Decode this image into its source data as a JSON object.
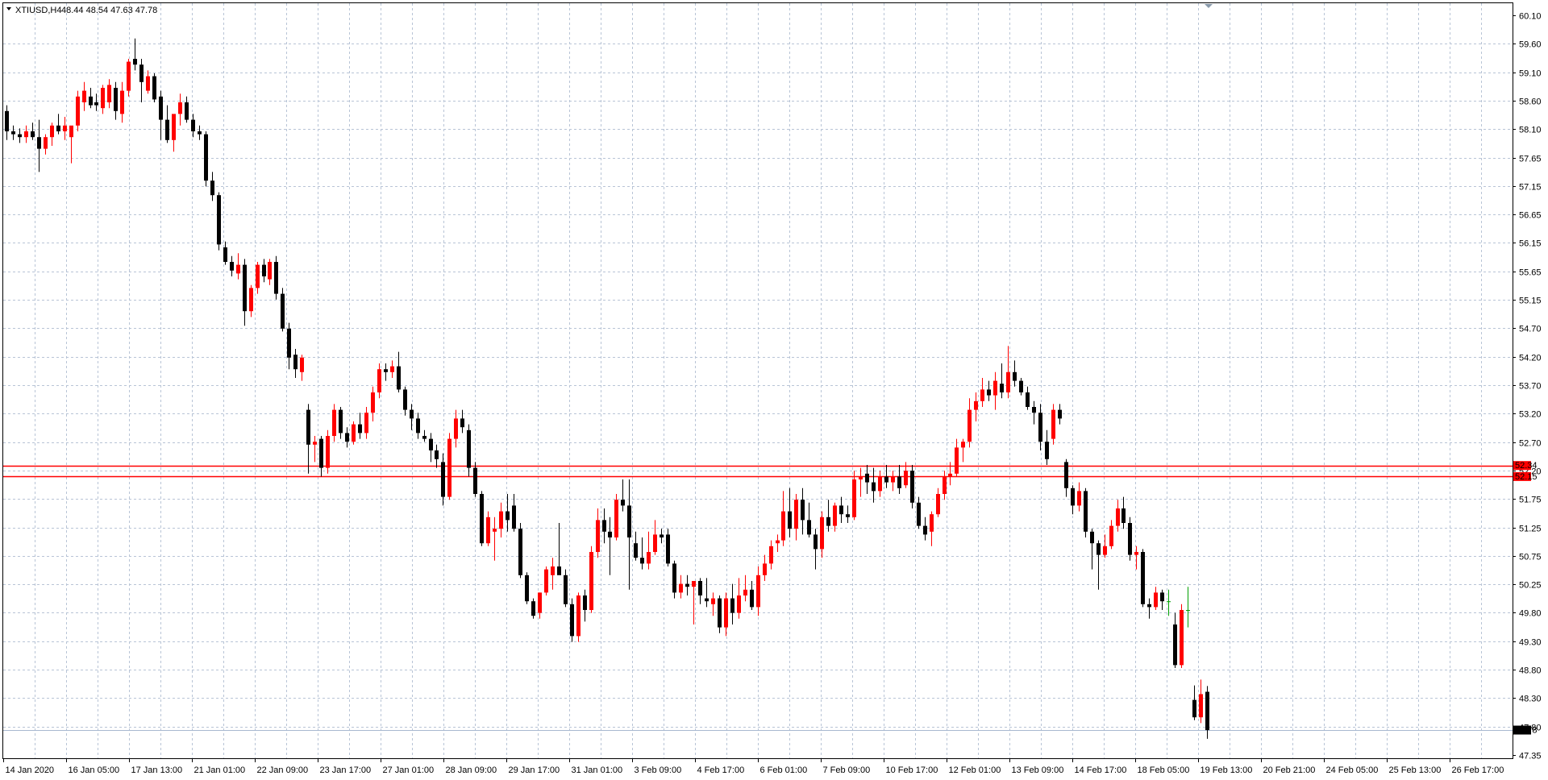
{
  "window": {
    "symbol_label": "XTIUSD,H4",
    "ohlc_readout": "48.44 48.54 47.63 47.78"
  },
  "colors": {
    "background": "#ffffff",
    "grid": "#b8c4d6",
    "axis": "#000000",
    "bull_candle": "#ff0000",
    "bear_candle": "#000000",
    "doji": "#00a000",
    "level_line": "#ff0000",
    "bid_line": "#a8b8d0"
  },
  "chart_data": {
    "type": "candlestick",
    "title": "",
    "ylim": [
      47.35,
      60.1
    ],
    "y_ticks": [
      "60.10",
      "59.60",
      "59.10",
      "58.60",
      "58.10",
      "57.65",
      "57.15",
      "56.65",
      "56.15",
      "55.65",
      "55.15",
      "54.70",
      "54.20",
      "53.70",
      "53.20",
      "52.70",
      "52.20",
      "51.75",
      "51.25",
      "50.75",
      "50.25",
      "49.80",
      "49.30",
      "48.80",
      "48.30",
      "47.80",
      "47.35"
    ],
    "x_tick_labels": [
      "14 Jan 2020",
      "16 Jan 05:00",
      "17 Jan 13:00",
      "21 Jan 01:00",
      "22 Jan 09:00",
      "23 Jan 17:00",
      "27 Jan 01:00",
      "28 Jan 09:00",
      "29 Jan 17:00",
      "31 Jan 01:00",
      "3 Feb 09:00",
      "4 Feb 17:00",
      "6 Feb 01:00",
      "7 Feb 09:00",
      "10 Feb 17:00",
      "12 Feb 01:00",
      "13 Feb 09:00",
      "14 Feb 17:00",
      "18 Feb 05:00",
      "19 Feb 13:00",
      "20 Feb 21:00",
      "24 Feb 05:00",
      "25 Feb 13:00",
      "26 Feb 17:00"
    ],
    "horizontal_levels": [
      {
        "price": 52.34,
        "label": "52.34"
      },
      {
        "price": 52.15,
        "label": "52.15"
      }
    ],
    "current_price": {
      "price": 47.78,
      "label": "47.78"
    },
    "candles": [
      [
        58.45,
        58.55,
        57.95,
        58.1
      ],
      [
        58.1,
        58.2,
        57.95,
        58.05
      ],
      [
        58.05,
        58.15,
        57.9,
        58.0
      ],
      [
        58.0,
        58.2,
        57.9,
        58.1
      ],
      [
        58.1,
        58.25,
        57.95,
        58.0
      ],
      [
        58.0,
        58.3,
        57.4,
        57.8
      ],
      [
        57.8,
        58.05,
        57.7,
        58.0
      ],
      [
        58.0,
        58.25,
        57.85,
        58.2
      ],
      [
        58.2,
        58.4,
        58.05,
        58.1
      ],
      [
        58.1,
        58.35,
        57.95,
        58.2
      ],
      [
        58.0,
        58.15,
        57.55,
        58.2
      ],
      [
        58.2,
        58.8,
        58.1,
        58.7
      ],
      [
        58.6,
        58.95,
        58.45,
        58.8
      ],
      [
        58.7,
        58.85,
        58.5,
        58.55
      ],
      [
        58.6,
        58.75,
        58.45,
        58.55
      ],
      [
        58.5,
        58.9,
        58.4,
        58.85
      ],
      [
        58.6,
        59.0,
        58.5,
        58.9
      ],
      [
        58.85,
        58.95,
        58.3,
        58.45
      ],
      [
        58.4,
        58.95,
        58.25,
        58.8
      ],
      [
        58.8,
        59.35,
        58.7,
        59.3
      ],
      [
        59.35,
        59.7,
        59.15,
        59.25
      ],
      [
        59.25,
        59.35,
        58.6,
        58.95
      ],
      [
        58.8,
        59.15,
        58.75,
        59.05
      ],
      [
        59.05,
        59.1,
        58.6,
        58.65
      ],
      [
        58.7,
        58.8,
        57.95,
        58.3
      ],
      [
        58.3,
        58.55,
        57.9,
        57.95
      ],
      [
        57.95,
        58.35,
        57.75,
        58.4
      ],
      [
        58.4,
        58.75,
        58.2,
        58.6
      ],
      [
        58.6,
        58.7,
        58.25,
        58.3
      ],
      [
        58.3,
        58.4,
        58.0,
        58.1
      ],
      [
        58.1,
        58.2,
        57.95,
        58.05
      ],
      [
        58.05,
        58.1,
        57.15,
        57.25
      ],
      [
        57.25,
        57.4,
        56.9,
        57.0
      ],
      [
        57.0,
        57.05,
        56.05,
        56.15
      ],
      [
        56.1,
        56.2,
        55.8,
        55.85
      ],
      [
        55.85,
        55.95,
        55.6,
        55.7
      ],
      [
        55.65,
        56.0,
        55.55,
        55.8
      ],
      [
        55.8,
        55.9,
        54.75,
        55.0
      ],
      [
        55.0,
        55.45,
        54.9,
        55.4
      ],
      [
        55.4,
        55.85,
        55.3,
        55.8
      ],
      [
        55.8,
        55.9,
        55.5,
        55.6
      ],
      [
        55.55,
        55.9,
        55.45,
        55.85
      ],
      [
        55.85,
        55.95,
        55.2,
        55.3
      ],
      [
        55.3,
        55.4,
        54.65,
        54.7
      ],
      [
        54.7,
        54.8,
        54.0,
        54.2
      ],
      [
        54.25,
        54.35,
        53.85,
        54.0
      ],
      [
        53.95,
        54.25,
        53.8,
        54.2
      ],
      [
        53.3,
        53.4,
        52.2,
        52.7
      ],
      [
        52.7,
        52.85,
        52.4,
        52.75
      ],
      [
        52.8,
        52.85,
        52.15,
        52.3
      ],
      [
        52.3,
        52.95,
        52.2,
        52.85
      ],
      [
        52.85,
        53.4,
        52.75,
        53.3
      ],
      [
        53.3,
        53.35,
        52.8,
        52.9
      ],
      [
        52.9,
        53.0,
        52.65,
        52.75
      ],
      [
        52.75,
        53.1,
        52.7,
        53.05
      ],
      [
        53.05,
        53.25,
        52.8,
        52.9
      ],
      [
        52.9,
        53.35,
        52.8,
        53.25
      ],
      [
        53.25,
        53.7,
        53.1,
        53.6
      ],
      [
        53.6,
        54.1,
        53.5,
        54.0
      ],
      [
        54.0,
        54.1,
        53.8,
        53.95
      ],
      [
        53.95,
        54.15,
        53.85,
        54.05
      ],
      [
        54.05,
        54.3,
        53.6,
        53.65
      ],
      [
        53.65,
        53.7,
        53.2,
        53.3
      ],
      [
        53.3,
        53.4,
        52.95,
        53.15
      ],
      [
        53.15,
        53.25,
        52.8,
        52.9
      ],
      [
        52.85,
        52.95,
        52.75,
        52.8
      ],
      [
        52.8,
        52.9,
        52.4,
        52.6
      ],
      [
        52.6,
        52.7,
        52.3,
        52.45
      ],
      [
        52.4,
        52.55,
        51.65,
        51.8
      ],
      [
        51.8,
        52.9,
        51.75,
        52.8
      ],
      [
        52.8,
        53.3,
        52.65,
        53.15
      ],
      [
        53.15,
        53.3,
        52.9,
        53.0
      ],
      [
        52.95,
        53.05,
        52.15,
        52.3
      ],
      [
        52.3,
        52.4,
        51.8,
        51.85
      ],
      [
        51.85,
        51.9,
        50.95,
        51.0
      ],
      [
        51.0,
        51.55,
        50.95,
        51.45
      ],
      [
        51.2,
        51.45,
        50.7,
        51.25
      ],
      [
        51.25,
        51.7,
        51.1,
        51.55
      ],
      [
        51.55,
        51.85,
        51.2,
        51.4
      ],
      [
        51.65,
        51.85,
        51.2,
        51.25
      ],
      [
        51.25,
        51.35,
        50.4,
        50.45
      ],
      [
        50.45,
        50.5,
        49.95,
        50.0
      ],
      [
        50.0,
        50.05,
        49.7,
        49.75
      ],
      [
        49.8,
        50.15,
        49.7,
        50.15
      ],
      [
        50.15,
        50.6,
        50.1,
        50.55
      ],
      [
        50.45,
        50.75,
        50.2,
        50.6
      ],
      [
        50.6,
        51.35,
        50.55,
        50.45
      ],
      [
        50.45,
        50.55,
        49.9,
        49.95
      ],
      [
        49.95,
        50.05,
        49.3,
        49.4
      ],
      [
        49.4,
        50.15,
        49.3,
        50.1
      ],
      [
        50.1,
        50.2,
        49.65,
        49.85
      ],
      [
        49.85,
        50.95,
        49.8,
        50.85
      ],
      [
        50.85,
        51.6,
        50.75,
        51.4
      ],
      [
        51.4,
        51.6,
        51.0,
        51.2
      ],
      [
        51.2,
        51.45,
        50.45,
        51.1
      ],
      [
        51.1,
        51.85,
        51.05,
        51.75
      ],
      [
        51.75,
        52.1,
        51.55,
        51.65
      ],
      [
        51.65,
        52.1,
        50.2,
        51.1
      ],
      [
        51.0,
        51.2,
        50.7,
        50.75
      ],
      [
        50.75,
        51.1,
        50.55,
        50.65
      ],
      [
        50.65,
        51.2,
        50.55,
        50.85
      ],
      [
        50.85,
        51.4,
        50.8,
        51.15
      ],
      [
        51.15,
        51.25,
        51.0,
        51.1
      ],
      [
        51.15,
        51.25,
        50.6,
        50.65
      ],
      [
        50.65,
        50.7,
        50.05,
        50.15
      ],
      [
        50.15,
        50.45,
        50.05,
        50.3
      ],
      [
        50.3,
        50.45,
        50.1,
        50.25
      ],
      [
        50.25,
        50.35,
        49.6,
        50.35
      ],
      [
        50.35,
        50.4,
        49.95,
        50.1
      ],
      [
        50.05,
        50.4,
        49.9,
        50.0
      ],
      [
        49.95,
        50.15,
        49.75,
        50.05
      ],
      [
        50.05,
        50.1,
        49.45,
        49.55
      ],
      [
        49.55,
        50.15,
        49.4,
        50.05
      ],
      [
        50.05,
        50.3,
        49.6,
        49.8
      ],
      [
        49.8,
        50.4,
        49.7,
        50.1
      ],
      [
        50.1,
        50.45,
        50.0,
        50.2
      ],
      [
        50.2,
        50.35,
        49.85,
        49.9
      ],
      [
        49.9,
        50.6,
        49.75,
        50.45
      ],
      [
        50.45,
        50.8,
        50.35,
        50.65
      ],
      [
        50.65,
        51.05,
        50.55,
        50.95
      ],
      [
        51.0,
        51.15,
        50.85,
        51.05
      ],
      [
        51.05,
        51.9,
        50.95,
        51.55
      ],
      [
        51.55,
        51.95,
        51.1,
        51.25
      ],
      [
        51.25,
        51.85,
        51.05,
        51.75
      ],
      [
        51.75,
        51.95,
        51.15,
        51.4
      ],
      [
        51.4,
        51.7,
        51.1,
        51.15
      ],
      [
        51.15,
        51.25,
        50.55,
        50.9
      ],
      [
        50.9,
        51.55,
        50.75,
        51.45
      ],
      [
        51.45,
        51.75,
        51.2,
        51.3
      ],
      [
        51.3,
        51.7,
        51.2,
        51.65
      ],
      [
        51.65,
        51.8,
        51.35,
        51.5
      ],
      [
        51.5,
        51.65,
        51.35,
        51.45
      ],
      [
        51.45,
        52.25,
        51.4,
        52.1
      ],
      [
        52.1,
        52.3,
        51.8,
        52.15
      ],
      [
        52.2,
        52.35,
        51.85,
        52.05
      ],
      [
        52.05,
        52.3,
        51.7,
        51.9
      ],
      [
        51.9,
        52.25,
        51.8,
        52.15
      ],
      [
        52.15,
        52.35,
        51.95,
        52.05
      ],
      [
        52.05,
        52.25,
        51.9,
        52.15
      ],
      [
        52.15,
        52.35,
        51.85,
        51.95
      ],
      [
        52.0,
        52.4,
        51.95,
        52.25
      ],
      [
        52.25,
        52.35,
        51.6,
        51.7
      ],
      [
        51.7,
        51.8,
        51.25,
        51.3
      ],
      [
        51.3,
        51.45,
        51.05,
        51.15
      ],
      [
        51.2,
        51.55,
        50.95,
        51.5
      ],
      [
        51.5,
        51.95,
        51.45,
        51.85
      ],
      [
        51.85,
        52.25,
        51.75,
        52.15
      ],
      [
        52.15,
        52.4,
        52.0,
        52.2
      ],
      [
        52.2,
        52.8,
        52.15,
        52.65
      ],
      [
        52.65,
        52.8,
        52.4,
        52.75
      ],
      [
        52.75,
        53.5,
        52.65,
        53.3
      ],
      [
        53.3,
        53.6,
        53.1,
        53.45
      ],
      [
        53.45,
        53.85,
        53.35,
        53.65
      ],
      [
        53.65,
        53.8,
        53.45,
        53.55
      ],
      [
        53.55,
        53.95,
        53.3,
        53.8
      ],
      [
        53.75,
        54.1,
        53.5,
        53.6
      ],
      [
        53.6,
        54.4,
        53.5,
        53.95
      ],
      [
        53.95,
        54.15,
        53.7,
        53.8
      ],
      [
        53.8,
        53.85,
        53.55,
        53.6
      ],
      [
        53.6,
        53.7,
        53.3,
        53.35
      ],
      [
        53.35,
        53.45,
        53.05,
        53.25
      ],
      [
        53.25,
        53.4,
        52.6,
        52.75
      ],
      [
        52.75,
        52.95,
        52.35,
        52.45
      ],
      [
        52.8,
        53.4,
        52.7,
        53.3
      ],
      [
        53.3,
        53.4,
        53.05,
        53.15
      ],
      [
        52.4,
        52.45,
        51.8,
        51.95
      ],
      [
        51.95,
        52.0,
        51.5,
        51.65
      ],
      [
        51.65,
        52.05,
        51.55,
        51.9
      ],
      [
        51.9,
        51.95,
        51.1,
        51.2
      ],
      [
        51.2,
        51.25,
        50.55,
        51.0
      ],
      [
        51.0,
        51.05,
        50.2,
        50.8
      ],
      [
        50.8,
        51.15,
        50.75,
        50.95
      ],
      [
        50.95,
        51.4,
        50.9,
        51.3
      ],
      [
        51.3,
        51.75,
        51.2,
        51.6
      ],
      [
        51.6,
        51.8,
        51.25,
        51.35
      ],
      [
        51.35,
        51.45,
        50.7,
        50.8
      ],
      [
        50.8,
        50.95,
        50.55,
        50.85
      ],
      [
        50.85,
        50.9,
        49.9,
        49.95
      ],
      [
        49.95,
        50.05,
        49.7,
        49.9
      ],
      [
        49.9,
        50.25,
        49.85,
        50.15
      ],
      [
        50.15,
        50.2,
        49.85,
        50.0
      ],
      [
        50.0,
        50.2,
        49.75,
        50.0
      ],
      [
        49.6,
        49.8,
        48.85,
        48.9
      ],
      [
        48.9,
        49.95,
        48.85,
        49.85
      ],
      [
        49.85,
        50.25,
        49.55,
        49.85
      ],
      [
        48.3,
        48.55,
        47.95,
        48.0
      ],
      [
        48.0,
        48.65,
        47.9,
        48.4
      ],
      [
        48.44,
        48.54,
        47.63,
        47.78
      ]
    ]
  }
}
